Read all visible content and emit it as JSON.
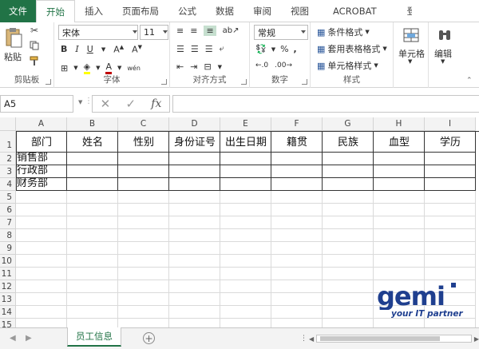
{
  "ribbon_tabs": {
    "file": "文件",
    "home": "开始",
    "insert": "插入",
    "page_layout": "页面布局",
    "formulas": "公式",
    "data": "数据",
    "review": "审阅",
    "view": "视图",
    "acrobat": "ACROBAT",
    "partial": "登"
  },
  "clipboard": {
    "paste": "粘贴",
    "label": "剪贴板"
  },
  "font": {
    "name": "宋体",
    "size": "11",
    "label": "字体",
    "wen": "wén"
  },
  "alignment": {
    "label": "对齐方式"
  },
  "number": {
    "format": "常规",
    "label": "数字"
  },
  "styles": {
    "conditional": "条件格式",
    "table": "套用表格格式",
    "cell_style": "单元格样式",
    "label": "样式"
  },
  "cells": {
    "label": "单元格"
  },
  "editing": {
    "label": "编辑"
  },
  "formula_bar": {
    "name_box": "A5",
    "fx": "fx"
  },
  "grid": {
    "columns": [
      "A",
      "B",
      "C",
      "D",
      "E",
      "F",
      "G",
      "H",
      "I"
    ],
    "rows": [
      "1",
      "2",
      "3",
      "4",
      "5",
      "6",
      "7",
      "8",
      "9",
      "10",
      "11",
      "12",
      "13",
      "14",
      "15"
    ],
    "headers": [
      "部门",
      "姓名",
      "性别",
      "身份证号",
      "出生日期",
      "籍贯",
      "民族",
      "血型",
      "学历"
    ],
    "departments": [
      "销售部",
      "行政部",
      "财务部"
    ]
  },
  "sheet": {
    "tab": "员工信息"
  },
  "logo": {
    "word": "gemi",
    "tagline": "your IT partner"
  }
}
